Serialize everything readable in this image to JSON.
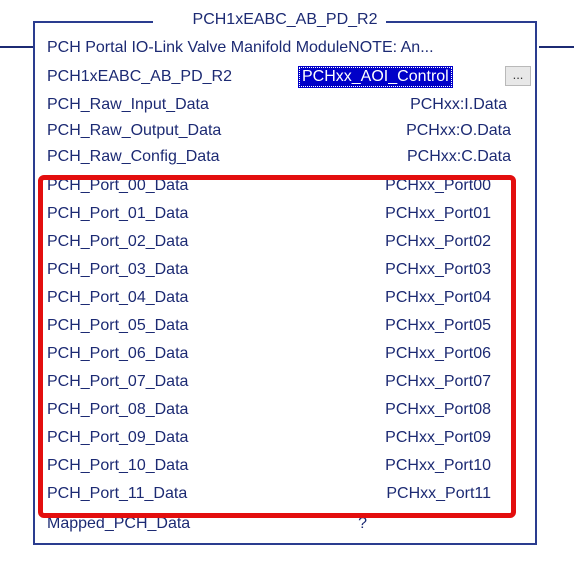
{
  "instruction": {
    "name": "PCH1xEABC_AB_PD_R2",
    "description": "PCH Portal IO-Link Valve Manifold ModuleNOTE: An..."
  },
  "instance": {
    "label": "PCH1xEABC_AB_PD_R2",
    "value": "PCHxx_AOI_Control",
    "browse_label": "..."
  },
  "parameters": [
    {
      "name": "PCH_Raw_Input_Data",
      "value": "PCHxx:I.Data"
    },
    {
      "name": "PCH_Raw_Output_Data",
      "value": "PCHxx:O.Data"
    },
    {
      "name": "PCH_Raw_Config_Data",
      "value": "PCHxx:C.Data"
    },
    {
      "name": "PCH_Port_00_Data",
      "value": "PCHxx_Port00"
    },
    {
      "name": "PCH_Port_01_Data",
      "value": "PCHxx_Port01"
    },
    {
      "name": "PCH_Port_02_Data",
      "value": "PCHxx_Port02"
    },
    {
      "name": "PCH_Port_03_Data",
      "value": "PCHxx_Port03"
    },
    {
      "name": "PCH_Port_04_Data",
      "value": "PCHxx_Port04"
    },
    {
      "name": "PCH_Port_05_Data",
      "value": "PCHxx_Port05"
    },
    {
      "name": "PCH_Port_06_Data",
      "value": "PCHxx_Port06"
    },
    {
      "name": "PCH_Port_07_Data",
      "value": "PCHxx_Port07"
    },
    {
      "name": "PCH_Port_08_Data",
      "value": "PCHxx_Port08"
    },
    {
      "name": "PCH_Port_09_Data",
      "value": "PCHxx_Port09"
    },
    {
      "name": "PCH_Port_10_Data",
      "value": "PCHxx_Port10"
    },
    {
      "name": "PCH_Port_11_Data",
      "value": "PCHxx_Port11"
    },
    {
      "name": "Mapped_PCH_Data",
      "value": "?"
    }
  ],
  "colors": {
    "text": "#1c2a73",
    "selection": "#0000c8",
    "highlight_border": "#e30e0e"
  }
}
